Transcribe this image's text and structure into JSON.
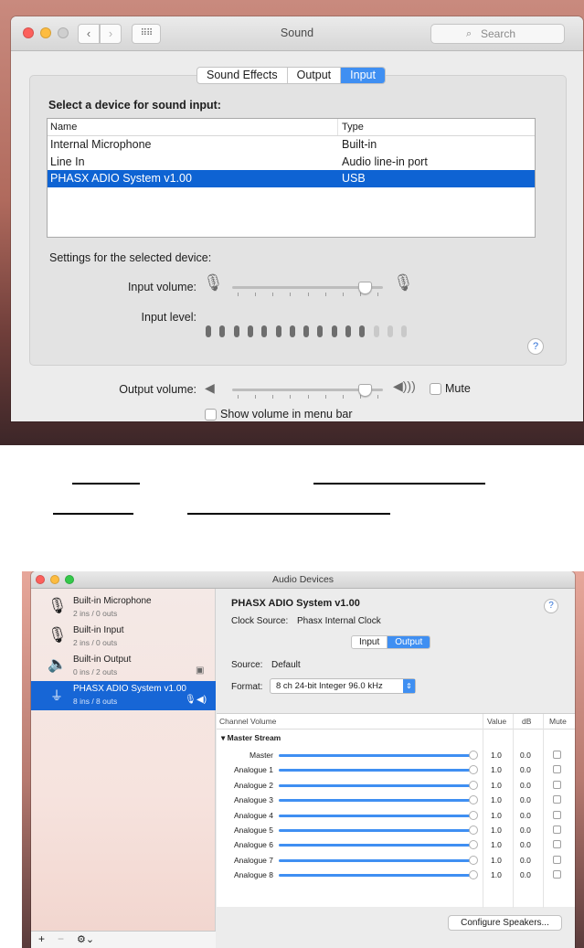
{
  "sound_window": {
    "title": "Sound",
    "search_placeholder": "Search",
    "tabs": [
      {
        "label": "Sound Effects",
        "active": false
      },
      {
        "label": "Output",
        "active": false
      },
      {
        "label": "Input",
        "active": true
      }
    ],
    "device_heading": "Select a device for sound input:",
    "columns": {
      "name": "Name",
      "type": "Type"
    },
    "devices": [
      {
        "name": "Internal Microphone",
        "type": "Built-in",
        "selected": false
      },
      {
        "name": "Line In",
        "type": "Audio line-in port",
        "selected": false
      },
      {
        "name": "PHASX ADIO System v1.00",
        "type": "USB",
        "selected": true
      }
    ],
    "settings_heading": "Settings for the selected device:",
    "input_volume_label": "Input volume:",
    "input_volume_fraction": 0.85,
    "input_level_label": "Input level:",
    "input_level": {
      "total_bars": 15,
      "lit_bars": 12
    },
    "output_volume_label": "Output volume:",
    "output_volume_fraction": 0.85,
    "mute_label": "Mute",
    "mute_checked": false,
    "menu_bar_label": "Show volume in menu bar",
    "menu_bar_checked": false,
    "help_icon": "?"
  },
  "audio_devices_window": {
    "title": "Audio Devices",
    "devices": [
      {
        "name": "Built-in Microphone",
        "io": "2 ins / 0 outs",
        "icon": "microphone-icon",
        "selected": false
      },
      {
        "name": "Built-in Input",
        "io": "2 ins / 0 outs",
        "icon": "microphone-icon",
        "selected": false
      },
      {
        "name": "Built-in Output",
        "io": "0 ins / 2 outs",
        "icon": "speaker-icon",
        "selected": false
      },
      {
        "name": "PHASX ADIO System v1.00",
        "io": "8 ins / 8 outs",
        "icon": "usb-icon",
        "selected": true
      }
    ],
    "selected_device_title": "PHASX ADIO System v1.00",
    "clock_source_label": "Clock Source:",
    "clock_source_value": "Phasx Internal Clock",
    "tabs": [
      {
        "label": "Input",
        "active": false
      },
      {
        "label": "Output",
        "active": true
      }
    ],
    "source_label": "Source:",
    "source_value": "Default",
    "format_label": "Format:",
    "format_value": "8 ch 24-bit Integer 96.0 kHz",
    "table_headers": {
      "channel": "Channel Volume",
      "value": "Value",
      "db": "dB",
      "mute": "Mute"
    },
    "group_label": "Master Stream",
    "channels": [
      {
        "name": "Master",
        "value": "1.0",
        "db": "0.0"
      },
      {
        "name": "Analogue 1",
        "value": "1.0",
        "db": "0.0"
      },
      {
        "name": "Analogue 2",
        "value": "1.0",
        "db": "0.0"
      },
      {
        "name": "Analogue 3",
        "value": "1.0",
        "db": "0.0"
      },
      {
        "name": "Analogue 4",
        "value": "1.0",
        "db": "0.0"
      },
      {
        "name": "Analogue 5",
        "value": "1.0",
        "db": "0.0"
      },
      {
        "name": "Analogue 6",
        "value": "1.0",
        "db": "0.0"
      },
      {
        "name": "Analogue 7",
        "value": "1.0",
        "db": "0.0"
      },
      {
        "name": "Analogue 8",
        "value": "1.0",
        "db": "0.0"
      }
    ],
    "configure_button": "Configure Speakers...",
    "help_icon": "?",
    "add_label": "+",
    "remove_label": "−"
  },
  "colors": {
    "accent": "#3f8ff2",
    "selection": "#0e63d3"
  }
}
